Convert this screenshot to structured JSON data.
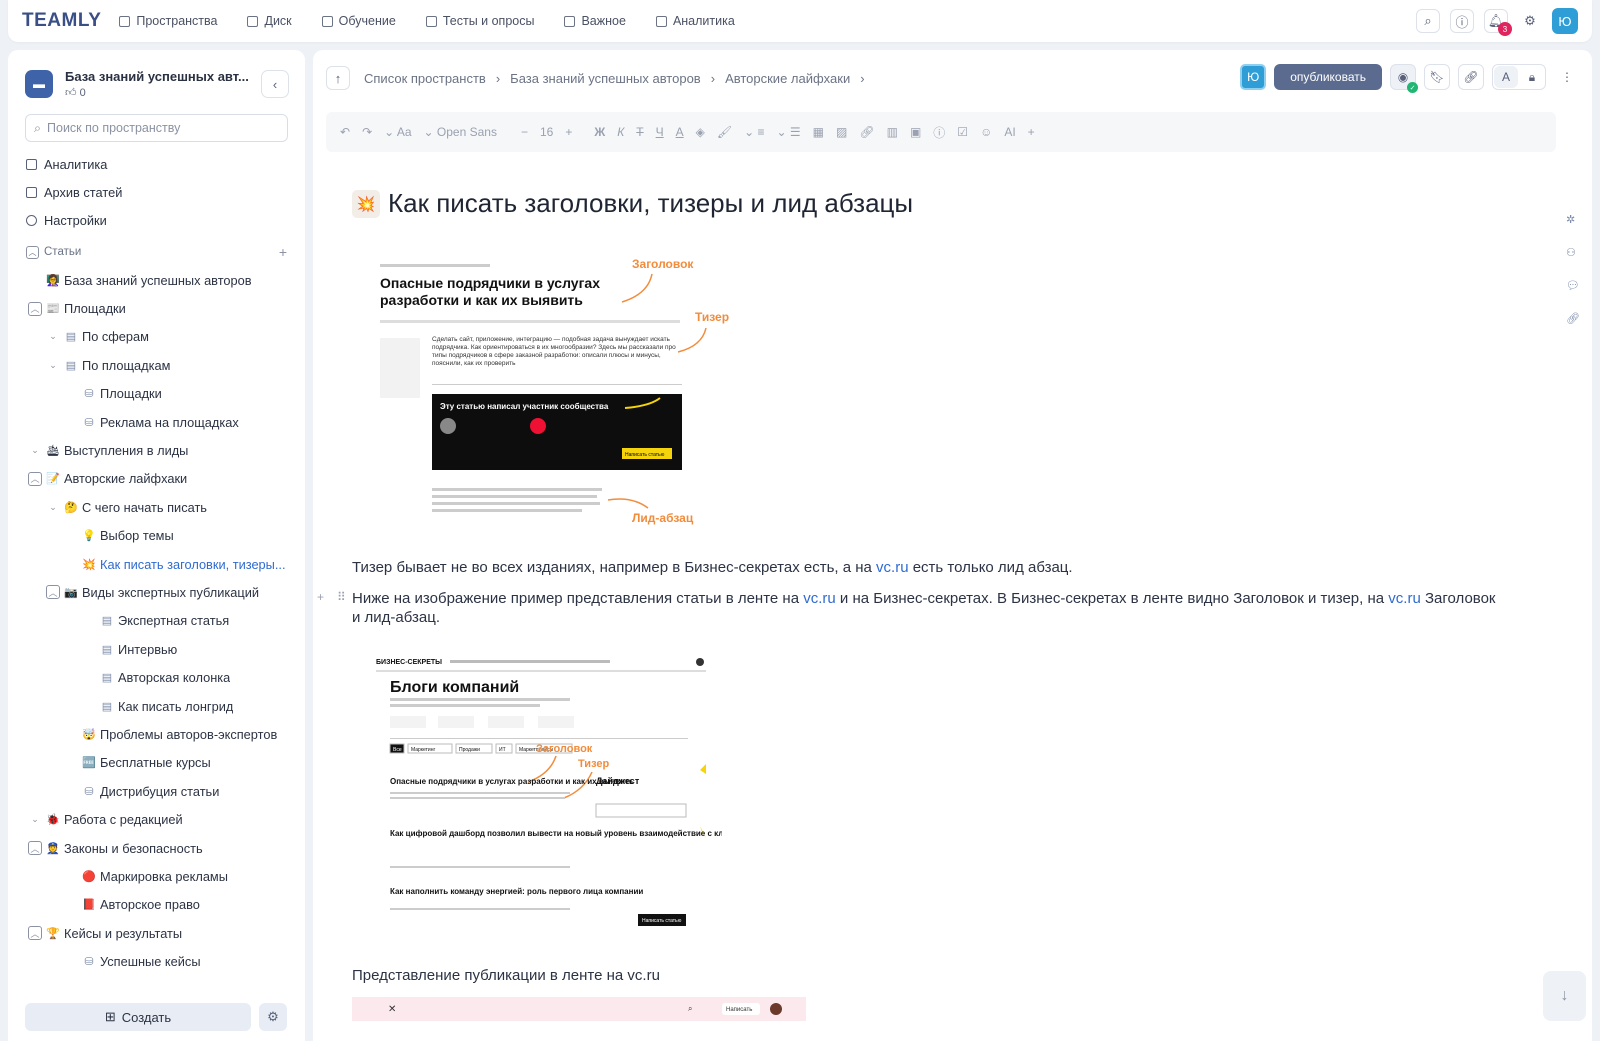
{
  "topnav": {
    "logo": "TEAMLY",
    "items": [
      {
        "label": "Пространства",
        "icon": "spaces-icon"
      },
      {
        "label": "Диск",
        "icon": "folder-icon"
      },
      {
        "label": "Обучение",
        "icon": "graduation-icon"
      },
      {
        "label": "Тесты и опросы",
        "icon": "tests-icon"
      },
      {
        "label": "Важное",
        "icon": "bookmark-icon"
      },
      {
        "label": "Аналитика",
        "icon": "analytics-icon"
      }
    ],
    "notifications_count": "3",
    "user_initial": "Ю"
  },
  "sidebar": {
    "space_title": "База знаний успешных авт...",
    "likes": "0",
    "search_placeholder": "Поиск по пространству",
    "links": [
      {
        "label": "Аналитика"
      },
      {
        "label": "Архив статей"
      },
      {
        "label": "Настройки"
      }
    ],
    "section_label": "Статьи",
    "tree": [
      {
        "label": "База знаний успешных авторов",
        "emoji": "👩‍🏫",
        "indent": 0,
        "toggle": ""
      },
      {
        "label": "Площадки",
        "emoji": "📰",
        "indent": 0,
        "toggle": "box"
      },
      {
        "label": "По сферам",
        "emoji": "▤",
        "indent": 1,
        "toggle": "chev"
      },
      {
        "label": "По площадкам",
        "emoji": "▤",
        "indent": 1,
        "toggle": "chev"
      },
      {
        "label": "Площадки",
        "emoji": "⛁",
        "indent": 2,
        "toggle": ""
      },
      {
        "label": "Реклама на площадках",
        "emoji": "⛁",
        "indent": 2,
        "toggle": ""
      },
      {
        "label": "Выступления в лиды",
        "emoji": "🛳",
        "indent": 0,
        "toggle": "chev"
      },
      {
        "label": "Авторские лайфхаки",
        "emoji": "📝",
        "indent": 0,
        "toggle": "box"
      },
      {
        "label": "С чего начать писать",
        "emoji": "🤔",
        "indent": 1,
        "toggle": "chev"
      },
      {
        "label": "Выбор темы",
        "emoji": "💡",
        "indent": 2,
        "toggle": ""
      },
      {
        "label": "Как писать заголовки, тизеры...",
        "emoji": "💥",
        "indent": 2,
        "toggle": "",
        "active": true
      },
      {
        "label": "Виды экспертных публикаций",
        "emoji": "📷",
        "indent": 1,
        "toggle": "box"
      },
      {
        "label": "Экспертная статья",
        "emoji": "▤",
        "indent": 3,
        "toggle": ""
      },
      {
        "label": "Интервью",
        "emoji": "▤",
        "indent": 3,
        "toggle": ""
      },
      {
        "label": "Авторская колонка",
        "emoji": "▤",
        "indent": 3,
        "toggle": ""
      },
      {
        "label": "Как писать лонгрид",
        "emoji": "▤",
        "indent": 3,
        "toggle": ""
      },
      {
        "label": "Проблемы авторов-экспертов",
        "emoji": "🤯",
        "indent": 2,
        "toggle": ""
      },
      {
        "label": "Бесплатные курсы",
        "emoji": "🆓",
        "indent": 2,
        "toggle": ""
      },
      {
        "label": "Дистрибуция статьи",
        "emoji": "⛁",
        "indent": 2,
        "toggle": ""
      },
      {
        "label": "Работа с редакцией",
        "emoji": "🐞",
        "indent": 0,
        "toggle": "chev"
      },
      {
        "label": "Законы и безопасность",
        "emoji": "👮",
        "indent": 0,
        "toggle": "box"
      },
      {
        "label": "Маркировка рекламы",
        "emoji": "🔴",
        "indent": 2,
        "toggle": ""
      },
      {
        "label": "Авторское право",
        "emoji": "📕",
        "indent": 2,
        "toggle": ""
      },
      {
        "label": "Кейсы и результаты",
        "emoji": "🏆",
        "indent": 0,
        "toggle": "box"
      },
      {
        "label": "Успешные кейсы",
        "emoji": "⛁",
        "indent": 2,
        "toggle": ""
      }
    ],
    "create_label": "Создать"
  },
  "main": {
    "breadcrumb": [
      "Список пространств",
      "База знаний успешных авторов",
      "Авторские лайфхаки"
    ],
    "publish_label": "опубликовать",
    "editor": {
      "font": "Open Sans",
      "size": "16",
      "ai_label": "AI"
    },
    "title": "Как писать заголовки, тизеры и лид абзацы",
    "img1": {
      "headline": "Опасные подрядчики в услугах разработки и как их выявить",
      "label_title": "Заголовок",
      "label_teaser": "Тизер",
      "label_lead": "Лид-абзац",
      "teaser_text": "Сделать сайт, приложение, интеграцию — подобная задача вынуждает искать подрядчика. Как ориентироваться в их многообразии? Здесь мы рассказали про типы подрядчиков в сфере заказной разработки: описали плюсы и минусы, пояснили, как их проверить",
      "banner": "Эту статью написал участник сообщества",
      "banner_btn": "Написать статью"
    },
    "para1": {
      "before": "Тизер бывает не во всех изданиях, например в Бизнес-секретах есть, а на ",
      "link": "vc.ru",
      "after": " есть только лид абзац."
    },
    "para2": {
      "t1": "Ниже на изображение пример представления статьи в ленте на ",
      "link1": "vc.ru",
      "t2": " и на Бизнес-секретах. В Бизнес-секретах в ленте видно Заголовок и тизер, на ",
      "link2": "vc.ru",
      "t3": " Заголовок",
      "line2": "и лид-абзац."
    },
    "img2": {
      "brand": "БИЗНЕС-СЕКРЕТЫ",
      "heading": "Блоги компаний",
      "tabs": [
        "Все",
        "Маркетинг",
        "Продажи",
        "ИТ",
        "Маркетплейсы"
      ],
      "label_title": "Заголовок",
      "label_teaser": "Тизер",
      "a1": "Опасные подрядчики в услугах разработки и как их выявить",
      "digest": "Дайджест",
      "a2": "Как цифровой дашборд позволил вывести на новый уровень взаимодействие с клиентом",
      "a3": "Как наполнить команду энергией: роль первого лица компании",
      "btn": "Написать статью"
    },
    "para3": "Представление публикации в ленте на vc.ru",
    "img3": {
      "btn": "Написать"
    }
  }
}
